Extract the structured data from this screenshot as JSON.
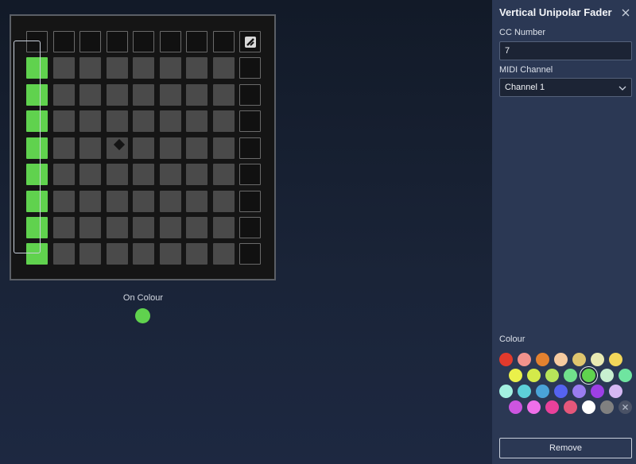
{
  "grid": {
    "on_colour_label": "On Colour",
    "on_colour": "#60d24e",
    "pad_off_colour": "#4a4a4a",
    "fader_level": 8
  },
  "panel": {
    "title": "Vertical Unipolar Fader",
    "cc_label": "CC Number",
    "cc_value": "7",
    "midi_label": "MIDI Channel",
    "midi_value": "Channel 1",
    "colour_label": "Colour",
    "remove_label": "Remove",
    "selected_colour": "#60d24e",
    "palette": [
      "#e23a2c",
      "#f2928c",
      "#e4812f",
      "#f6cba0",
      "#dfc56e",
      "#e9eab3",
      "#f2d65a",
      "#eaf04a",
      "#d4ea4a",
      "#b8e35a",
      "#71e08c",
      "#60d24e",
      "#c8efd0",
      "#6fe5a0",
      "#a3f0e0",
      "#5dcfd9",
      "#4aa3d8",
      "#5563f0",
      "#9a7cf0",
      "#9d3fe6",
      "#d5b8f3",
      "#cc55e0",
      "#ef6fe9",
      "#e9419b",
      "#e5577a",
      "#ffffff",
      "#808080",
      "none"
    ]
  }
}
